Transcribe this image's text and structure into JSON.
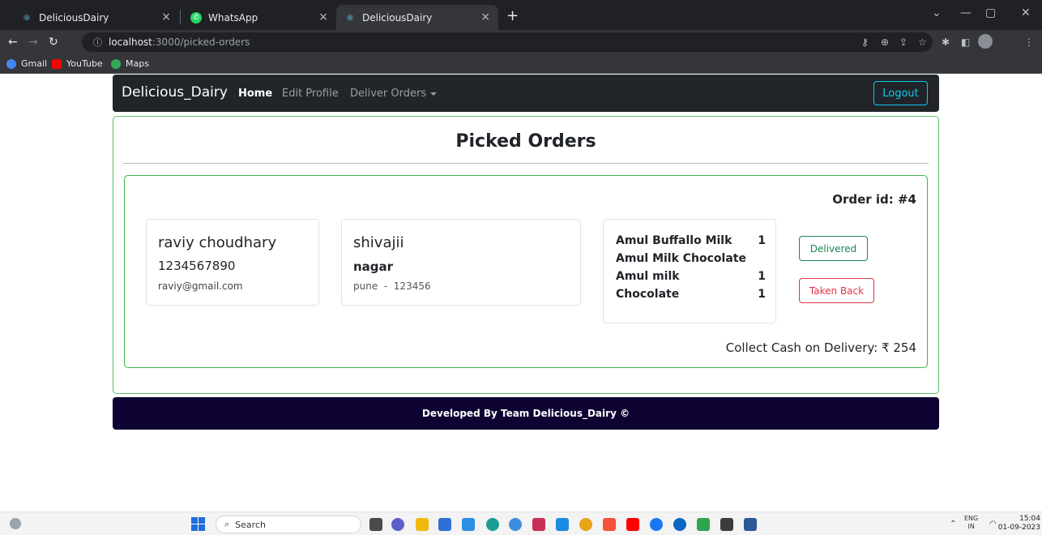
{
  "browser": {
    "tabs": [
      {
        "title": "DeliciousDairy",
        "icon": "react-icon",
        "close": "×"
      },
      {
        "title": "WhatsApp",
        "icon": "whatsapp-icon",
        "close": "×"
      },
      {
        "title": "DeliciousDairy",
        "icon": "react-icon",
        "close": "×",
        "active": true
      }
    ],
    "new_tab": "+",
    "url_host": "localhost",
    "url_path": ":3000/picked-orders",
    "bookmarks": [
      {
        "label": "Gmail",
        "icon": "google-icon",
        "color": "#4285f4"
      },
      {
        "label": "YouTube",
        "icon": "youtube-icon",
        "color": "#ff0000"
      },
      {
        "label": "Maps",
        "icon": "maps-icon",
        "color": "#34a853"
      }
    ]
  },
  "navbar": {
    "brand": "Delicious_Dairy",
    "links": [
      "Home",
      "Edit Profile",
      "Deliver Orders"
    ],
    "logout": "Logout"
  },
  "page": {
    "title": "Picked Orders"
  },
  "order": {
    "order_id": "Order id: #4",
    "customer": {
      "name": "raviy choudhary",
      "phone": "1234567890",
      "email": "raviy@gmail.com"
    },
    "address": {
      "line1": "shivajii",
      "line2": "nagar",
      "line3": "pune  -  123456"
    },
    "items": [
      {
        "name": "Amul Buffallo Milk",
        "qty": "1"
      },
      {
        "name": "Amul Milk Chocolate",
        "qty": ""
      },
      {
        "name": "Amul milk",
        "qty": "1"
      },
      {
        "name": "Chocolate",
        "qty": "1"
      }
    ],
    "buttons": {
      "delivered": "Delivered",
      "taken_back": "Taken Back"
    },
    "cash": "Collect Cash on Delivery: ₹ 254"
  },
  "footer": {
    "text": "Developed By Team Delicious_Dairy ©"
  },
  "taskbar": {
    "search": "Search",
    "lang_top": "ENG",
    "lang_bottom": "IN",
    "time": "15:04",
    "date": "01-09-2023"
  },
  "colors": {
    "success": "#198754",
    "danger": "#dc3545",
    "info": "#0dcaf0",
    "footer_bg": "#0d0231",
    "navbar_bg": "#212529"
  }
}
